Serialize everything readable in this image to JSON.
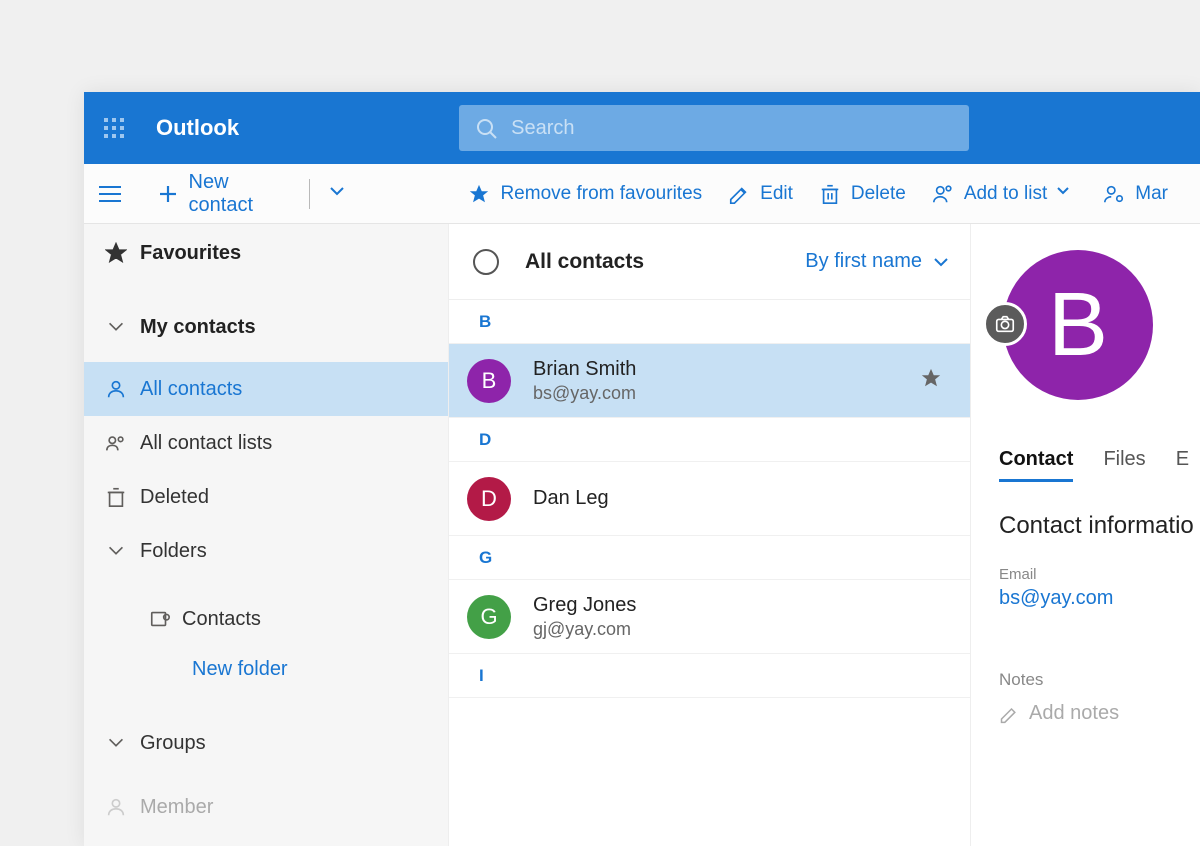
{
  "header": {
    "app_title": "Outlook",
    "search_placeholder": "Search"
  },
  "toolbar": {
    "new_contact": "New contact",
    "remove_fav": "Remove from favourites",
    "edit": "Edit",
    "delete": "Delete",
    "add_to_list": "Add to list",
    "manage": "Mar"
  },
  "sidebar": {
    "favourites": "Favourites",
    "my_contacts": "My contacts",
    "all_contacts": "All contacts",
    "all_contact_lists": "All contact lists",
    "deleted": "Deleted",
    "folders": "Folders",
    "contacts_folder": "Contacts",
    "new_folder": "New folder",
    "groups": "Groups",
    "member": "Member"
  },
  "list": {
    "title": "All contacts",
    "sort": "By first name",
    "groups": [
      {
        "letter": "B",
        "items": [
          {
            "initial": "B",
            "name": "Brian Smith",
            "email": "bs@yay.com",
            "color": "#8e24aa",
            "starred": true,
            "selected": true
          }
        ]
      },
      {
        "letter": "D",
        "items": [
          {
            "initial": "D",
            "name": "Dan Leg",
            "email": "",
            "color": "#b31a47",
            "starred": false,
            "selected": false
          }
        ]
      },
      {
        "letter": "G",
        "items": [
          {
            "initial": "G",
            "name": "Greg Jones",
            "email": "gj@yay.com",
            "color": "#43a047",
            "starred": false,
            "selected": false
          }
        ]
      },
      {
        "letter": "I",
        "items": []
      }
    ]
  },
  "detail": {
    "initial": "B",
    "tabs": {
      "contact": "Contact",
      "files": "Files",
      "extra": "E"
    },
    "section": "Contact informatio",
    "email_label": "Email",
    "email_value": "bs@yay.com",
    "notes_label": "Notes",
    "add_notes": "Add notes"
  }
}
